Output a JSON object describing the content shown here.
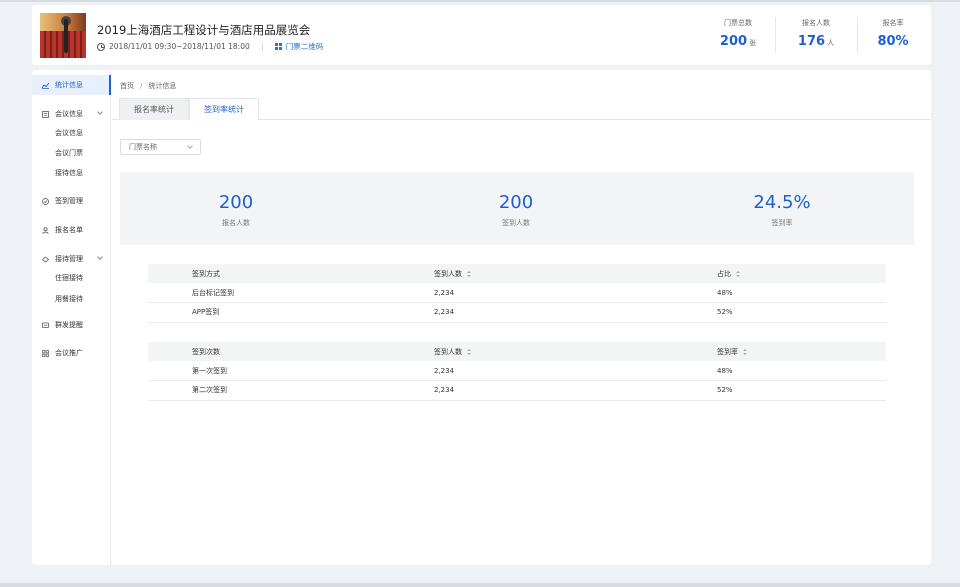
{
  "header": {
    "event_title": "2019上海酒店工程设计与酒店用品展览会",
    "time_range": "2018/11/01 09:30~2018/11/01 18:00",
    "qr_link_label": "门票二维码",
    "stats": [
      {
        "label": "门票总数",
        "value": "200",
        "unit": "张"
      },
      {
        "label": "报名人数",
        "value": "176",
        "unit": "人"
      },
      {
        "label": "报名率",
        "value": "80%",
        "unit": ""
      }
    ]
  },
  "sidebar": {
    "items": [
      {
        "label": "统计信息",
        "icon": "chart-icon",
        "active": true
      },
      {
        "label": "会议信息",
        "icon": "document-icon"
      },
      {
        "label": "会议信息",
        "icon": ""
      },
      {
        "label": "会议门票",
        "icon": ""
      },
      {
        "label": "接待信息",
        "icon": ""
      },
      {
        "label": "签到管理",
        "icon": "checkin-icon"
      },
      {
        "label": "报名名单",
        "icon": "user-icon"
      },
      {
        "label": "接待管理",
        "icon": "reception-icon"
      },
      {
        "label": "住宿接待",
        "icon": ""
      },
      {
        "label": "用餐接待",
        "icon": ""
      },
      {
        "label": "群发提醒",
        "icon": "message-icon"
      },
      {
        "label": "会议推广",
        "icon": "grid-icon"
      }
    ]
  },
  "breadcrumb": {
    "home": "首页",
    "separator": "/",
    "current": "统计信息"
  },
  "tabs": [
    {
      "label": "报名率统计"
    },
    {
      "label": "签到率统计",
      "active": true
    }
  ],
  "filter": {
    "ticket_select_placeholder": "门票名称"
  },
  "kpis": [
    {
      "value": "200",
      "label": "报名人数"
    },
    {
      "value": "200",
      "label": "签到人数"
    },
    {
      "value": "24.5%",
      "label": "签到率"
    }
  ],
  "table_method": {
    "headers": [
      "签到方式",
      "签到人数",
      "占比"
    ],
    "rows": [
      [
        "后台标记签到",
        "2,234",
        "48%"
      ],
      [
        "APP签到",
        "2,234",
        "52%"
      ]
    ]
  },
  "table_times": {
    "headers": [
      "签到次数",
      "签到人数",
      "签到率"
    ],
    "rows": [
      [
        "第一次签到",
        "2,234",
        "48%"
      ],
      [
        "第二次签到",
        "2,234",
        "52%"
      ]
    ]
  },
  "colors": {
    "accent": "#1d5fd3",
    "active_bg": "#e8f0fd",
    "panel_bg": "#f3f4f6"
  }
}
